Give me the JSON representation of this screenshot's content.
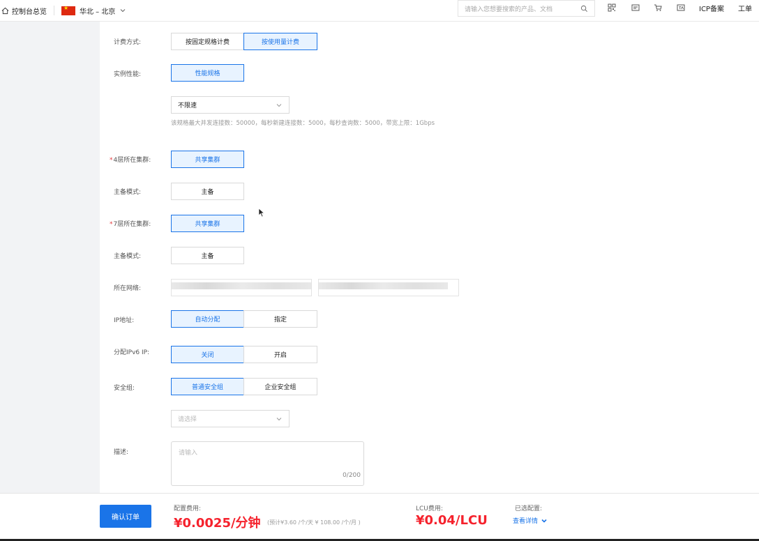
{
  "topbar": {
    "home_label": "控制台总览",
    "region_label": "华北 – 北京",
    "search_placeholder": "请输入您想要搜索的产品、文档",
    "icp_label": "ICP备案",
    "ticket_label": "工单",
    "icons": [
      "home-icon",
      "china-flag-icon",
      "chevron-down-icon",
      "search-icon",
      "qr-code-icon",
      "message-icon",
      "cart-icon",
      "language-icon"
    ]
  },
  "form": {
    "billing": {
      "label": "计费方式:",
      "options": [
        "按固定规格计费",
        "按使用量计费"
      ],
      "selected": "按使用量计费"
    },
    "performance": {
      "label": "实例性能:",
      "option": "性能规格",
      "speed_value": "不限速",
      "spec_hint": "该规格最大并发连接数：50000，每秒新建连接数：5000，每秒查询数：5000，带宽上限：1Gbps"
    },
    "l4_cluster": {
      "required": "*",
      "label": "4层所在集群:",
      "option": "共享集群"
    },
    "l4_mode": {
      "label": "主备模式:",
      "option": "主备"
    },
    "l7_cluster": {
      "required": "*",
      "label": "7层所在集群:",
      "option": "共享集群"
    },
    "l7_mode": {
      "label": "主备模式:",
      "option": "主备"
    },
    "network": {
      "label": "所在网络:"
    },
    "ip": {
      "label": "IP地址:",
      "options": [
        "自动分配",
        "指定"
      ],
      "selected": "自动分配"
    },
    "ipv6": {
      "label": "分配IPv6 IP:",
      "options": [
        "关闭",
        "开启"
      ],
      "selected": "关闭"
    },
    "security": {
      "label": "安全组:",
      "options": [
        "普通安全组",
        "企业安全组"
      ],
      "selected": "普通安全组",
      "select_placeholder": "请选择"
    },
    "description": {
      "label": "描述:",
      "placeholder": "请输入",
      "counter": "0/200"
    }
  },
  "footer": {
    "confirm_label": "确认订单",
    "config_fee_label": "配置费用:",
    "config_fee_value": "¥0.0025/分钟",
    "config_fee_sub": "(预计¥3.60 /个/天 ¥ 108.00 /个/月 )",
    "lcu_fee_label": "LCU费用:",
    "lcu_fee_value": "¥0.04/LCU",
    "selected_label": "已选配置:",
    "details_label": "查看详情"
  },
  "colors": {
    "accent": "#1a74e8",
    "price": "#f5222d",
    "selected_bg": "#e8f3ff"
  }
}
